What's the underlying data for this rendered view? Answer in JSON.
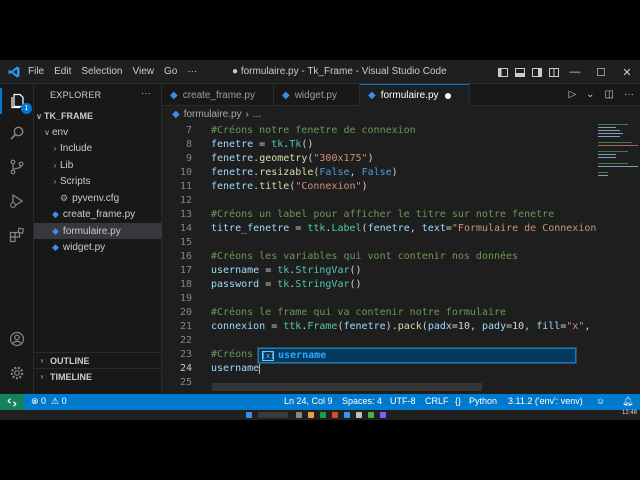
{
  "window": {
    "title": "● formulaire.py - Tk_Frame - Visual Studio Code",
    "menu": [
      "File",
      "Edit",
      "Selection",
      "View",
      "Go",
      "···"
    ]
  },
  "activity_bar": {
    "items": [
      "explorer-icon",
      "search-icon",
      "source-control-icon",
      "run-debug-icon",
      "extensions-icon",
      "account-icon",
      "settings-gear-icon"
    ],
    "explorer_badge": "1"
  },
  "sidebar": {
    "header": "EXPLORER",
    "more": "···",
    "root": "TK_FRAME",
    "tree": [
      {
        "label": "env",
        "chev": "∨",
        "indent": 1
      },
      {
        "label": "Include",
        "chev": "›",
        "indent": 2
      },
      {
        "label": "Lib",
        "chev": "›",
        "indent": 2
      },
      {
        "label": "Scripts",
        "chev": "›",
        "indent": 2
      },
      {
        "label": "pyvenv.cfg",
        "chev": "",
        "indent": 2,
        "icon": "gear"
      },
      {
        "label": "create_frame.py",
        "chev": "",
        "indent": 1,
        "icon": "py"
      },
      {
        "label": "formulaire.py",
        "chev": "",
        "indent": 1,
        "icon": "py",
        "selected": true
      },
      {
        "label": "widget.py",
        "chev": "",
        "indent": 1,
        "icon": "py"
      }
    ],
    "outline": "OUTLINE",
    "timeline": "TIMELINE"
  },
  "tabs": [
    {
      "label": "create_frame.py",
      "active": false
    },
    {
      "label": "widget.py",
      "active": false
    },
    {
      "label": "formulaire.py",
      "active": true,
      "modified": true
    }
  ],
  "breadcrumb": {
    "file": "formulaire.py",
    "sep": "›",
    "rest": "..."
  },
  "editor": {
    "lines": [
      {
        "n": "7",
        "html": "<span class='cm'>#Créons notre fenetre de connexion</span>"
      },
      {
        "n": "8",
        "html": "<span class='var'>fenetre</span> = <span class='cls'>tk</span>.<span class='cls'>Tk</span>()"
      },
      {
        "n": "9",
        "html": "<span class='var'>fenetre</span>.<span class='fn'>geometry</span>(<span class='str'>\"300x175\"</span>)"
      },
      {
        "n": "10",
        "html": "<span class='var'>fenetre</span>.<span class='fn'>resizable</span>(<span class='kw'>False</span>, <span class='kw'>False</span>)"
      },
      {
        "n": "11",
        "html": "<span class='var'>fenetre</span>.<span class='fn'>title</span>(<span class='str'>\"Connexion\"</span>)"
      },
      {
        "n": "12",
        "html": ""
      },
      {
        "n": "13",
        "html": "<span class='cm'>#Créons un label pour afficher le titre sur notre fenetre</span>"
      },
      {
        "n": "14",
        "html": "<span class='var'>titre_fenetre</span> = <span class='cls'>ttk</span>.<span class='cls'>Label</span>(<span class='var'>fenetre</span>, <span class='var'>text</span>=<span class='str'>\"Formulaire de Connexion\"</span>, <span class='var'>f</span>"
      },
      {
        "n": "15",
        "html": ""
      },
      {
        "n": "16",
        "html": "<span class='cm'>#Créons les variables qui vont contenir nos données</span>"
      },
      {
        "n": "17",
        "html": "<span class='var'>username</span> = <span class='cls'>tk</span>.<span class='cls'>StringVar</span>()"
      },
      {
        "n": "18",
        "html": "<span class='var'>password</span> = <span class='cls'>tk</span>.<span class='cls'>StringVar</span>()"
      },
      {
        "n": "19",
        "html": ""
      },
      {
        "n": "20",
        "html": "<span class='cm'>#Créons le frame qui va contenir notre formulaire</span>"
      },
      {
        "n": "21",
        "html": "<span class='var'>connexion</span> = <span class='cls'>ttk</span>.<span class='cls'>Frame</span>(<span class='var'>fenetre</span>).<span class='fn'>pack</span>(<span class='var'>padx</span>=10, <span class='var'>pady</span>=10, <span class='var'>fill</span>=<span class='str'>\"x\"</span>, <span class='var'>exp</span>"
      },
      {
        "n": "22",
        "html": ""
      },
      {
        "n": "23",
        "html": "<span class='cm'>#Créons</span>"
      },
      {
        "n": "24",
        "html": "<span class='var'>username</span><span class='cursor'></span>",
        "current": true
      },
      {
        "n": "25",
        "html": ""
      }
    ],
    "suggestion": {
      "match": "username",
      "kind": "variable"
    }
  },
  "status_bar": {
    "remote_icon": "remote-icon",
    "errors": "⊗ 0",
    "warnings": "⚠ 0",
    "position": "Ln 24, Col 9",
    "spaces": "Spaces: 4",
    "encoding": "UTF-8",
    "eol": "CRLF",
    "language": "Python",
    "interpreter": "3.11.2 ('env': venv)"
  },
  "taskbar": {
    "time": "12:48"
  },
  "colors": {
    "accent": "#007acc",
    "remote": "#16825d",
    "comment": "#6a9955",
    "string": "#ce9178"
  }
}
